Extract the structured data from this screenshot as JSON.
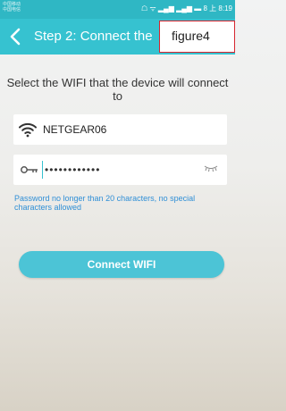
{
  "status_bar": {
    "carrier_line1": "中国移动",
    "carrier_line2": "中国电信",
    "icons_text": "ⓘ ☏ ᯤ 📶 ▮ 8 上 8:19",
    "time": "8:19"
  },
  "header": {
    "title": "Step 2: Connect the",
    "figure_label": "figure4",
    "accent_color": "#36c2d0"
  },
  "instruction": "Select the WIFI that the device will connect to",
  "ssid_field": {
    "icon": "wifi-icon",
    "value": "NETGEAR06"
  },
  "password_field": {
    "icon": "key-icon",
    "value": "••••••••••••",
    "toggle_icon": "eye-closed-icon"
  },
  "hint": "Password no longer than 20 characters, no special characters allowed",
  "connect_button": {
    "label": "Connect WIFI"
  }
}
